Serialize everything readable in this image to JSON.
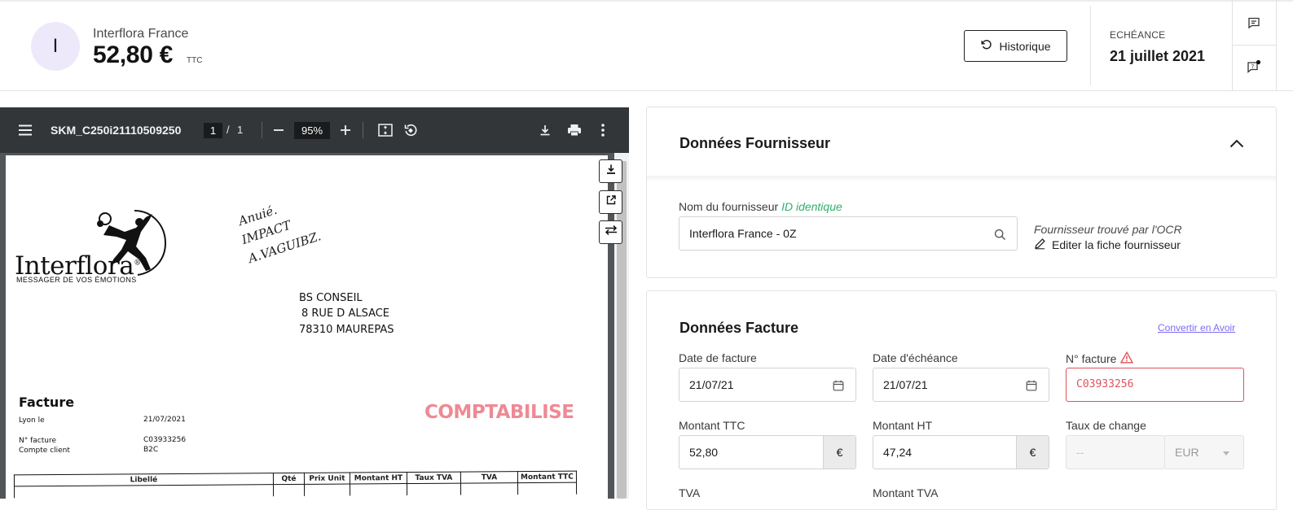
{
  "header": {
    "avatar_initial": "I",
    "supplier_name": "Interflora France",
    "amount": "52,80 €",
    "amount_suffix": "TTC",
    "history_button": "Historique",
    "due_label": "ECHÉANCE",
    "due_date": "21 juillet 2021",
    "side_icons": [
      "comment-icon",
      "comment-question-icon"
    ]
  },
  "viewer": {
    "filename": "SKM_C250i21110509250",
    "page_current": "1",
    "page_separator": "/",
    "page_total": "1",
    "zoom": "95%",
    "icons": [
      "menu-icon",
      "zoom-out-icon",
      "zoom-in-icon",
      "fit-page-icon",
      "rotate-icon",
      "download-icon",
      "print-icon",
      "more-icon"
    ],
    "float_buttons": [
      "download-icon",
      "open-external-icon",
      "swap-icon"
    ]
  },
  "document": {
    "logo_text": "Interflora",
    "logo_trademark": "®",
    "logo_tagline": "MESSAGER DE VOS ÉMOTIONS",
    "handwriting": [
      "Anuié.",
      "IMPACT",
      "A.VAGUIBZ."
    ],
    "recipient_lines": [
      "BS CONSEIL",
      "8 RUE D ALSACE",
      "78310 MAUREPAS"
    ],
    "title": "Facture",
    "stamp": "COMPTABILISE",
    "info_labels": [
      "Lyon le",
      "N° facture",
      "Compte client"
    ],
    "info_values": [
      "21/07/2021",
      "C03933256",
      "B2C"
    ],
    "table_headers": [
      "Libellé",
      "Qté",
      "Prix Unit",
      "Montant HT",
      "Taux TVA",
      "TVA",
      "Montant TTC"
    ]
  },
  "supplier_card": {
    "title": "Données Fournisseur",
    "field_label": "Nom du fournisseur",
    "field_label_accent": "ID identique",
    "field_value": "Interflora France - 0Z",
    "ocr_note": "Fournisseur trouvé par l'OCR",
    "edit_link": "Editer la fiche fournisseur"
  },
  "invoice_card": {
    "title": "Données Facture",
    "convert_link": "Convertir en Avoir",
    "date_label": "Date de facture",
    "date_value": "21/07/21",
    "due_label": "Date d'échéance",
    "due_value": "21/07/21",
    "number_label": "N° facture",
    "number_value": "C03933256",
    "ttc_label": "Montant TTC",
    "ttc_value": "52,80",
    "ht_label": "Montant HT",
    "ht_value": "47,24",
    "currency_symbol": "€",
    "rate_label": "Taux de change",
    "rate_placeholder": "--",
    "currency_code": "EUR",
    "tva_label": "TVA",
    "tva_amount_label": "Montant TVA"
  },
  "colors": {
    "accent_purple": "#7b6cf2",
    "error_red": "#e0525b",
    "success_green": "#2fb06b",
    "stamp_pink": "#ee8a94"
  }
}
